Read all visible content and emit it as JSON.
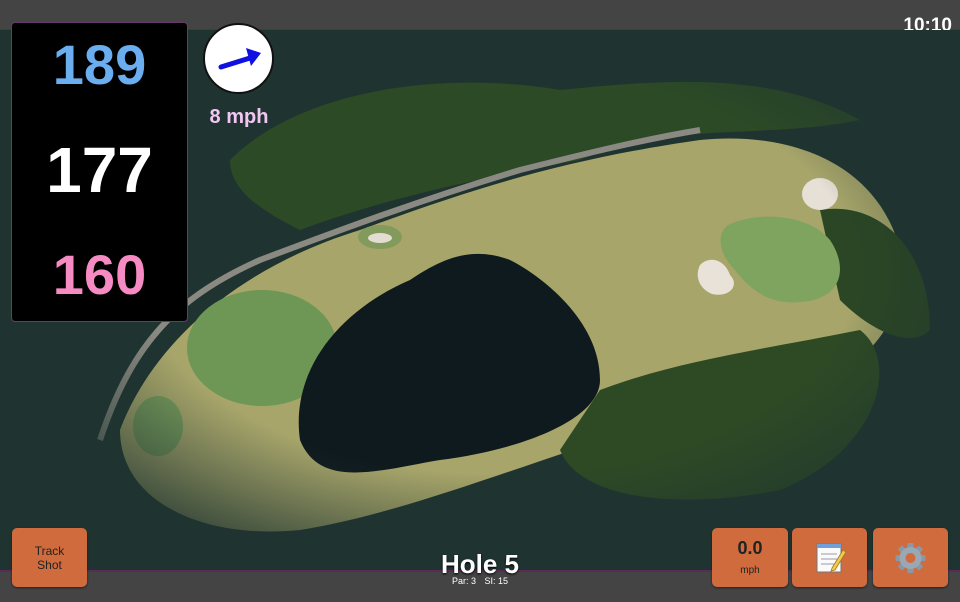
{
  "status": {
    "time": "10:10"
  },
  "yardages": {
    "back": "189",
    "middle": "177",
    "front": "160"
  },
  "wind": {
    "speed_label": "8 mph",
    "icon": "wind-arrow-icon"
  },
  "hole": {
    "title": "Hole 5",
    "par_label": "Par: 3",
    "si_label": "SI: 15"
  },
  "buttons": {
    "track_shot": "Track\nShot",
    "speed_value": "0.0",
    "speed_unit": "mph",
    "notes_icon": "notepad-icon",
    "settings_icon": "gear-icon"
  },
  "colors": {
    "back_yardage": "#6aaef0",
    "front_yardage": "#f58bc2",
    "button": "#cf6b3d",
    "wind_arrow": "#1010e0"
  }
}
